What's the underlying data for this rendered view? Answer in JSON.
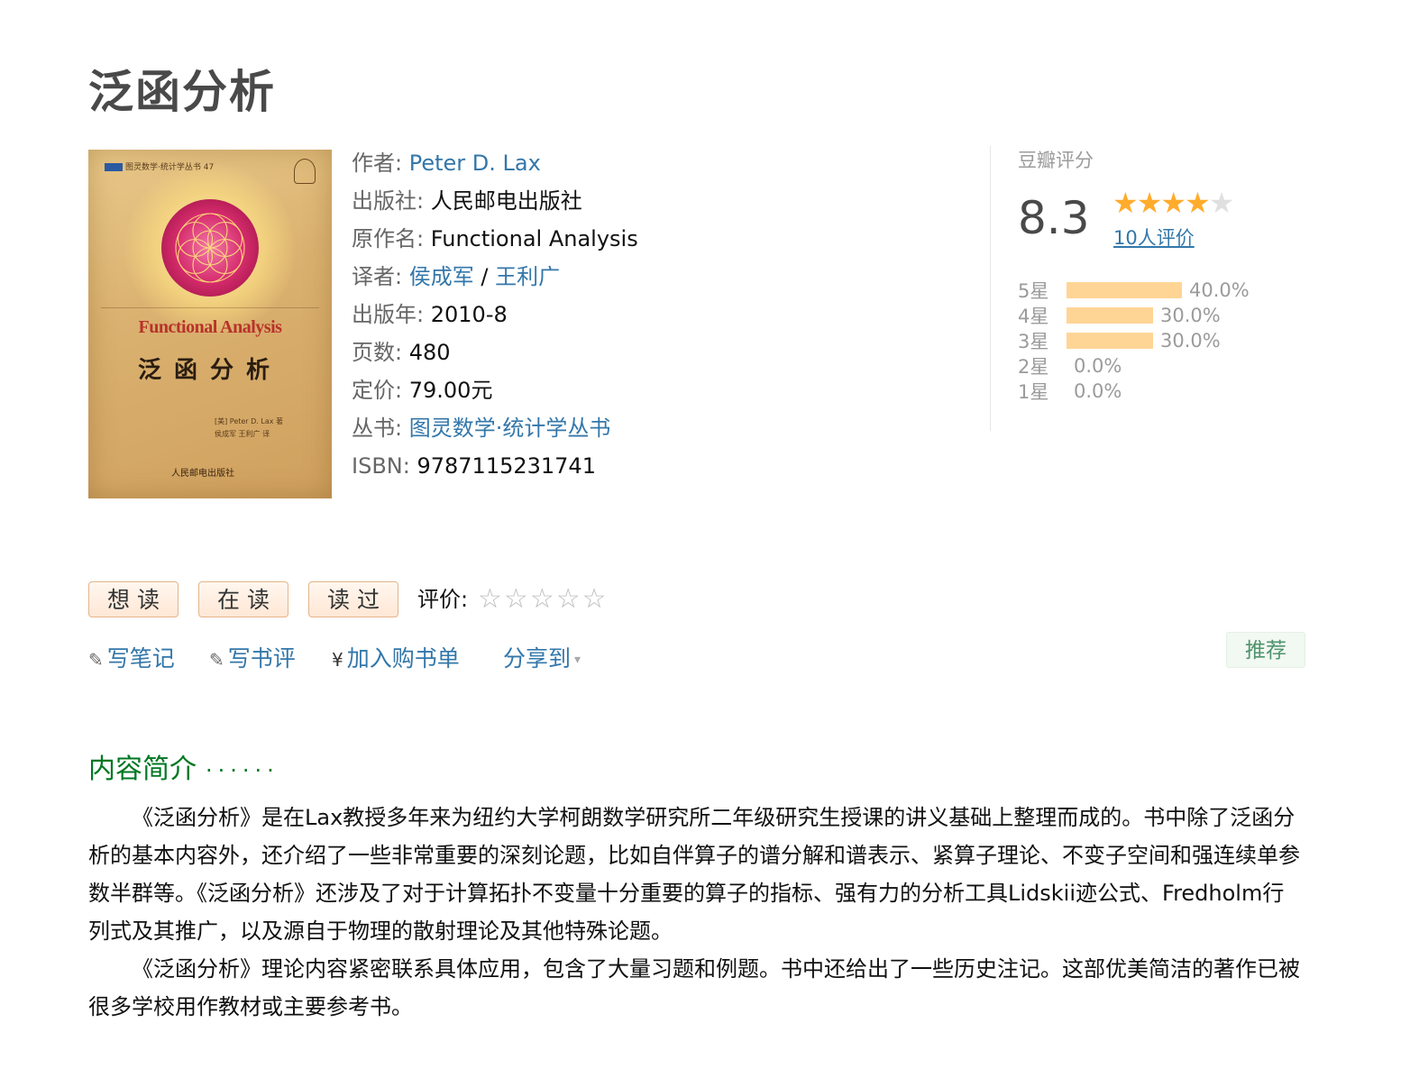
{
  "book": {
    "title": "泛函分析"
  },
  "cover": {
    "series_label": "图灵数学·统计学丛书 47",
    "title_en": "Functional Analysis",
    "title_cn": "泛函分析",
    "author_line": "[美] Peter D. Lax 著",
    "translator_line": "侯成军 王利广 译",
    "publisher": "人民邮电出版社"
  },
  "info": {
    "author_label": "作者:",
    "author": "Peter D. Lax",
    "publisher_label": "出版社:",
    "publisher": "人民邮电出版社",
    "original_title_label": "原作名:",
    "original_title": "Functional Analysis",
    "translator_label": "译者:",
    "translator_1": "侯成军",
    "translator_sep": " / ",
    "translator_2": "王利广",
    "pub_year_label": "出版年:",
    "pub_year": "2010-8",
    "pages_label": "页数:",
    "pages": "480",
    "price_label": "定价:",
    "price": "79.00元",
    "series_label": "丛书:",
    "series": "图灵数学·统计学丛书",
    "isbn_label": "ISBN:",
    "isbn": "9787115231741"
  },
  "rating": {
    "heading": "豆瓣评分",
    "score": "8.3",
    "stars_value": 4,
    "stars_max": 5,
    "count_label": "10人评价",
    "distribution": [
      {
        "label": "5星",
        "percent": 40.0,
        "percent_text": "40.0%"
      },
      {
        "label": "4星",
        "percent": 30.0,
        "percent_text": "30.0%"
      },
      {
        "label": "3星",
        "percent": 30.0,
        "percent_text": "30.0%"
      },
      {
        "label": "2星",
        "percent": 0.0,
        "percent_text": "0.0%"
      },
      {
        "label": "1星",
        "percent": 0.0,
        "percent_text": "0.0%"
      }
    ],
    "bar_color": "#ffd596",
    "star_color": "#ffac2d"
  },
  "buttons": {
    "want_read": "想读",
    "reading": "在读",
    "read": "读过",
    "rate_label": "评价:"
  },
  "actions": {
    "write_note": "写笔记",
    "write_review": "写书评",
    "add_to_cart": "加入购书单",
    "share": "分享到",
    "recommend": "推荐",
    "pencil_icon": "pencil-icon",
    "yen_icon": "yen-icon"
  },
  "intro": {
    "heading": "内容简介",
    "heading_dots": "······",
    "paragraph_1": "《泛函分析》是在Lax教授多年来为纽约大学柯朗数学研究所二年级研究生授课的讲义基础上整理而成的。书中除了泛函分析的基本内容外，还介绍了一些非常重要的深刻论题，比如自伴算子的谱分解和谱表示、紧算子理论、不变子空间和强连续单参数半群等。《泛函分析》还涉及了对于计算拓扑不变量十分重要的算子的指标、强有力的分析工具Lidskii迹公式、Fredholm行列式及其推广，以及源自于物理的散射理论及其他特殊论题。",
    "paragraph_2": "《泛函分析》理论内容紧密联系具体应用，包含了大量习题和例题。书中还给出了一些历史注记。这部优美简洁的著作已被很多学校用作教材或主要参考书。"
  },
  "colors": {
    "link": "#3377aa",
    "heading_green": "#007722",
    "button_border": "#e3b58a"
  }
}
